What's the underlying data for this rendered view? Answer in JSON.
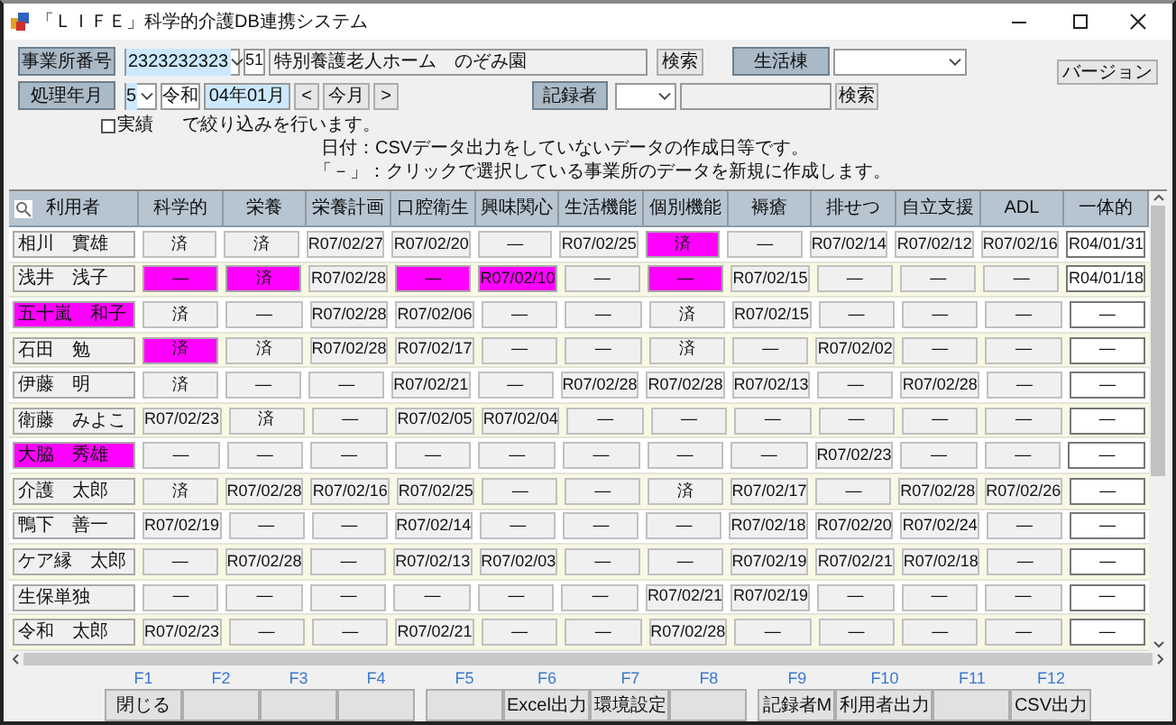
{
  "window": {
    "title": "「ＬＩＦＥ」科学的介護DB連携システム"
  },
  "form": {
    "office_label": "事業所番号",
    "office_code": "2323232323",
    "office_no": "51",
    "office_name": "特別養護老人ホーム　のぞみ園",
    "office_search": "検索",
    "ward_label": "生活棟",
    "version_button": "バージョン",
    "period_label": "処理年月",
    "era_select": "5",
    "era": "令和",
    "month": "04年01月",
    "prev": "<",
    "today": "今月",
    "next": ">",
    "recorder_label": "記録者",
    "recorder_search": "検索",
    "filter": {
      "label": "実績",
      "checked": false
    },
    "filter_text": "で絞り込みを行います。",
    "notes": [
      "日付：CSVデータ出力をしていないデータの作成日等です。",
      "「－」：クリックで選択している事業所のデータを新規に作成します。"
    ]
  },
  "table": {
    "columns": [
      "利用者",
      "科学的",
      "栄養",
      "栄養計画",
      "口腔衛生",
      "興味関心",
      "生活機能",
      "個別機能",
      "褥瘡",
      "排せつ",
      "自立支援",
      "ADL",
      "一体的"
    ],
    "rows": [
      {
        "cells": [
          {
            "text": "相川　實雄",
            "highlighted": false
          },
          {
            "text": "済",
            "highlighted": false
          },
          {
            "text": "済",
            "highlighted": false
          },
          {
            "text": "R07/02/27",
            "highlighted": false
          },
          {
            "text": "R07/02/20",
            "highlighted": false
          },
          {
            "text": "—",
            "highlighted": false
          },
          {
            "text": "R07/02/25",
            "highlighted": false
          },
          {
            "text": "済",
            "highlighted": true
          },
          {
            "text": "—",
            "highlighted": false
          },
          {
            "text": "R07/02/14",
            "highlighted": false
          },
          {
            "text": "R07/02/12",
            "highlighted": false
          },
          {
            "text": "R07/02/16",
            "highlighted": false
          },
          {
            "text": "R04/01/31",
            "highlighted": false
          }
        ]
      },
      {
        "cells": [
          {
            "text": "浅井　浅子",
            "highlighted": false
          },
          {
            "text": "—",
            "highlighted": true
          },
          {
            "text": "済",
            "highlighted": true
          },
          {
            "text": "R07/02/28",
            "highlighted": false
          },
          {
            "text": "—",
            "highlighted": true
          },
          {
            "text": "R07/02/10",
            "highlighted": true
          },
          {
            "text": "—",
            "highlighted": false
          },
          {
            "text": "—",
            "highlighted": true
          },
          {
            "text": "R07/02/15",
            "highlighted": false
          },
          {
            "text": "—",
            "highlighted": false
          },
          {
            "text": "—",
            "highlighted": false
          },
          {
            "text": "—",
            "highlighted": false
          },
          {
            "text": "R04/01/18",
            "highlighted": false
          }
        ]
      },
      {
        "cells": [
          {
            "text": "五十嵐　和子",
            "highlighted": true
          },
          {
            "text": "済",
            "highlighted": false
          },
          {
            "text": "—",
            "highlighted": false
          },
          {
            "text": "R07/02/28",
            "highlighted": false
          },
          {
            "text": "R07/02/06",
            "highlighted": false
          },
          {
            "text": "—",
            "highlighted": false
          },
          {
            "text": "—",
            "highlighted": false
          },
          {
            "text": "済",
            "highlighted": false
          },
          {
            "text": "R07/02/15",
            "highlighted": false
          },
          {
            "text": "—",
            "highlighted": false
          },
          {
            "text": "—",
            "highlighted": false
          },
          {
            "text": "—",
            "highlighted": false
          },
          {
            "text": "—",
            "highlighted": false
          }
        ]
      },
      {
        "cells": [
          {
            "text": "石田　勉",
            "highlighted": false
          },
          {
            "text": "済",
            "highlighted": true
          },
          {
            "text": "済",
            "highlighted": false
          },
          {
            "text": "R07/02/28",
            "highlighted": false
          },
          {
            "text": "R07/02/17",
            "highlighted": false
          },
          {
            "text": "—",
            "highlighted": false
          },
          {
            "text": "—",
            "highlighted": false
          },
          {
            "text": "済",
            "highlighted": false
          },
          {
            "text": "—",
            "highlighted": false
          },
          {
            "text": "R07/02/02",
            "highlighted": false
          },
          {
            "text": "—",
            "highlighted": false
          },
          {
            "text": "—",
            "highlighted": false
          },
          {
            "text": "—",
            "highlighted": false
          }
        ]
      },
      {
        "cells": [
          {
            "text": "伊藤　明",
            "highlighted": false
          },
          {
            "text": "済",
            "highlighted": false
          },
          {
            "text": "—",
            "highlighted": false
          },
          {
            "text": "—",
            "highlighted": false
          },
          {
            "text": "R07/02/21",
            "highlighted": false
          },
          {
            "text": "—",
            "highlighted": false
          },
          {
            "text": "R07/02/28",
            "highlighted": false
          },
          {
            "text": "R07/02/28",
            "highlighted": false
          },
          {
            "text": "R07/02/13",
            "highlighted": false
          },
          {
            "text": "—",
            "highlighted": false
          },
          {
            "text": "R07/02/28",
            "highlighted": false
          },
          {
            "text": "—",
            "highlighted": false
          },
          {
            "text": "—",
            "highlighted": false
          }
        ]
      },
      {
        "cells": [
          {
            "text": "衛藤　みよこ",
            "highlighted": false
          },
          {
            "text": "R07/02/23",
            "highlighted": false
          },
          {
            "text": "済",
            "highlighted": false
          },
          {
            "text": "—",
            "highlighted": false
          },
          {
            "text": "R07/02/05",
            "highlighted": false
          },
          {
            "text": "R07/02/04",
            "highlighted": false
          },
          {
            "text": "—",
            "highlighted": false
          },
          {
            "text": "—",
            "highlighted": false
          },
          {
            "text": "—",
            "highlighted": false
          },
          {
            "text": "—",
            "highlighted": false
          },
          {
            "text": "—",
            "highlighted": false
          },
          {
            "text": "—",
            "highlighted": false
          },
          {
            "text": "—",
            "highlighted": false
          }
        ]
      },
      {
        "cells": [
          {
            "text": "大脇　秀雄",
            "highlighted": true
          },
          {
            "text": "—",
            "highlighted": false
          },
          {
            "text": "—",
            "highlighted": false
          },
          {
            "text": "—",
            "highlighted": false
          },
          {
            "text": "—",
            "highlighted": false
          },
          {
            "text": "—",
            "highlighted": false
          },
          {
            "text": "—",
            "highlighted": false
          },
          {
            "text": "—",
            "highlighted": false
          },
          {
            "text": "—",
            "highlighted": false
          },
          {
            "text": "R07/02/23",
            "highlighted": false
          },
          {
            "text": "—",
            "highlighted": false
          },
          {
            "text": "—",
            "highlighted": false
          },
          {
            "text": "—",
            "highlighted": false
          }
        ]
      },
      {
        "cells": [
          {
            "text": "介護　太郎",
            "highlighted": false
          },
          {
            "text": "済",
            "highlighted": false
          },
          {
            "text": "R07/02/28",
            "highlighted": false
          },
          {
            "text": "R07/02/16",
            "highlighted": false
          },
          {
            "text": "R07/02/25",
            "highlighted": false
          },
          {
            "text": "—",
            "highlighted": false
          },
          {
            "text": "—",
            "highlighted": false
          },
          {
            "text": "済",
            "highlighted": false
          },
          {
            "text": "R07/02/17",
            "highlighted": false
          },
          {
            "text": "—",
            "highlighted": false
          },
          {
            "text": "R07/02/28",
            "highlighted": false
          },
          {
            "text": "R07/02/26",
            "highlighted": false
          },
          {
            "text": "—",
            "highlighted": false
          }
        ]
      },
      {
        "cells": [
          {
            "text": "鴨下　善一",
            "highlighted": false
          },
          {
            "text": "R07/02/19",
            "highlighted": false
          },
          {
            "text": "—",
            "highlighted": false
          },
          {
            "text": "—",
            "highlighted": false
          },
          {
            "text": "R07/02/14",
            "highlighted": false
          },
          {
            "text": "—",
            "highlighted": false
          },
          {
            "text": "—",
            "highlighted": false
          },
          {
            "text": "—",
            "highlighted": false
          },
          {
            "text": "R07/02/18",
            "highlighted": false
          },
          {
            "text": "R07/02/20",
            "highlighted": false
          },
          {
            "text": "R07/02/24",
            "highlighted": false
          },
          {
            "text": "—",
            "highlighted": false
          },
          {
            "text": "—",
            "highlighted": false
          }
        ]
      },
      {
        "cells": [
          {
            "text": "ケア縁　太郎",
            "highlighted": false
          },
          {
            "text": "—",
            "highlighted": false
          },
          {
            "text": "R07/02/28",
            "highlighted": false
          },
          {
            "text": "—",
            "highlighted": false
          },
          {
            "text": "R07/02/13",
            "highlighted": false
          },
          {
            "text": "R07/02/03",
            "highlighted": false
          },
          {
            "text": "—",
            "highlighted": false
          },
          {
            "text": "—",
            "highlighted": false
          },
          {
            "text": "R07/02/19",
            "highlighted": false
          },
          {
            "text": "R07/02/21",
            "highlighted": false
          },
          {
            "text": "R07/02/18",
            "highlighted": false
          },
          {
            "text": "—",
            "highlighted": false
          },
          {
            "text": "—",
            "highlighted": false
          }
        ]
      },
      {
        "cells": [
          {
            "text": "生保単独",
            "highlighted": false
          },
          {
            "text": "—",
            "highlighted": false
          },
          {
            "text": "—",
            "highlighted": false
          },
          {
            "text": "—",
            "highlighted": false
          },
          {
            "text": "—",
            "highlighted": false
          },
          {
            "text": "—",
            "highlighted": false
          },
          {
            "text": "—",
            "highlighted": false
          },
          {
            "text": "R07/02/21",
            "highlighted": false
          },
          {
            "text": "R07/02/19",
            "highlighted": false
          },
          {
            "text": "—",
            "highlighted": false
          },
          {
            "text": "—",
            "highlighted": false
          },
          {
            "text": "—",
            "highlighted": false
          },
          {
            "text": "—",
            "highlighted": false
          }
        ]
      },
      {
        "cells": [
          {
            "text": "令和　太郎",
            "highlighted": false
          },
          {
            "text": "R07/02/23",
            "highlighted": false
          },
          {
            "text": "—",
            "highlighted": false
          },
          {
            "text": "—",
            "highlighted": false
          },
          {
            "text": "R07/02/21",
            "highlighted": false
          },
          {
            "text": "—",
            "highlighted": false
          },
          {
            "text": "—",
            "highlighted": false
          },
          {
            "text": "R07/02/28",
            "highlighted": false
          },
          {
            "text": "—",
            "highlighted": false
          },
          {
            "text": "—",
            "highlighted": false
          },
          {
            "text": "—",
            "highlighted": false
          },
          {
            "text": "—",
            "highlighted": false
          },
          {
            "text": "—",
            "highlighted": false
          }
        ]
      }
    ]
  },
  "function_keys": [
    {
      "key": "F1",
      "label": "閉じる"
    },
    {
      "key": "F2"
    },
    {
      "key": "F3"
    },
    {
      "key": "F4"
    },
    {
      "key": "F5"
    },
    {
      "key": "F6",
      "label": "Excel出力"
    },
    {
      "key": "F7",
      "label": "環境設定"
    },
    {
      "key": "F8"
    },
    {
      "key": "F9",
      "label": "記録者M"
    },
    {
      "key": "F10",
      "label": "利用者出力"
    },
    {
      "key": "F11"
    },
    {
      "key": "F12",
      "label": "CSV出力"
    }
  ]
}
